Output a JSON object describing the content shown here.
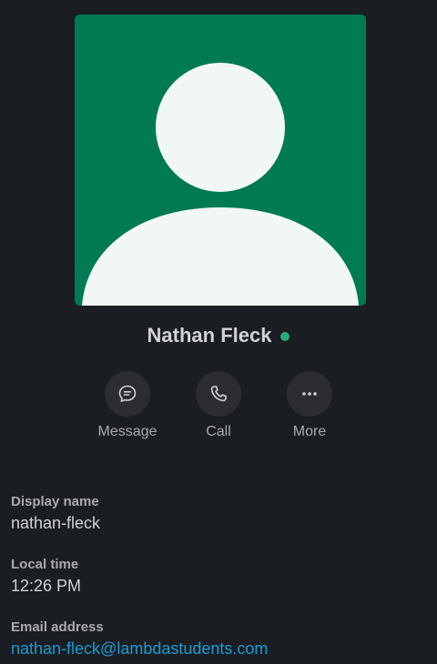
{
  "profile": {
    "name": "Nathan Fleck",
    "presence": "active",
    "presence_color": "#2bac76",
    "avatar_color": "#007a53"
  },
  "actions": [
    {
      "label": "Message",
      "icon": "message-icon"
    },
    {
      "label": "Call",
      "icon": "phone-icon"
    },
    {
      "label": "More",
      "icon": "more-icon"
    }
  ],
  "fields": {
    "display_name": {
      "label": "Display name",
      "value": "nathan-fleck"
    },
    "local_time": {
      "label": "Local time",
      "value": "12:26 PM"
    },
    "email": {
      "label": "Email address",
      "value": "nathan-fleck@lambdastudents.com"
    }
  },
  "colors": {
    "background": "#1a1d21",
    "link": "#1d9bd1"
  }
}
